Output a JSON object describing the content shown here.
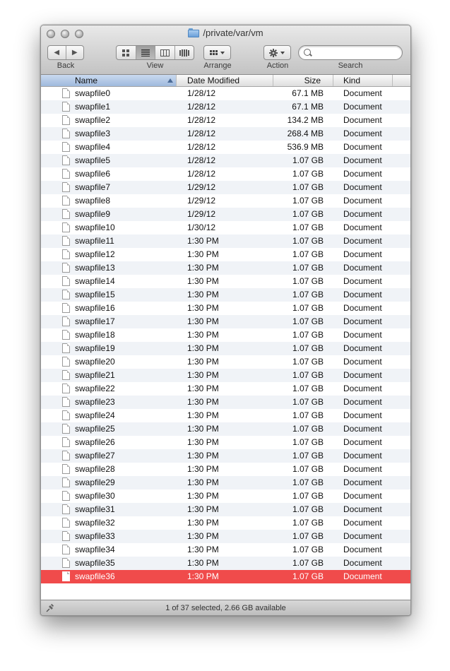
{
  "window": {
    "title": "/private/var/vm"
  },
  "toolbar": {
    "back_label": "Back",
    "view_label": "View",
    "arrange_label": "Arrange",
    "action_label": "Action",
    "search_label": "Search",
    "search_placeholder": "",
    "back_icon": "chevron-left-icon",
    "forward_icon": "chevron-right-icon",
    "view_icons": [
      "icon-view-icon",
      "list-view-icon",
      "column-view-icon",
      "cover-flow-icon"
    ],
    "arrange_icon": "arrange-grid-icon",
    "action_icon": "gear-icon"
  },
  "columns": {
    "name": "Name",
    "date": "Date Modified",
    "size": "Size",
    "kind": "Kind"
  },
  "files": [
    {
      "name": "swapfile0",
      "date": "1/28/12",
      "size": "67.1 MB",
      "kind": "Document"
    },
    {
      "name": "swapfile1",
      "date": "1/28/12",
      "size": "67.1 MB",
      "kind": "Document"
    },
    {
      "name": "swapfile2",
      "date": "1/28/12",
      "size": "134.2 MB",
      "kind": "Document"
    },
    {
      "name": "swapfile3",
      "date": "1/28/12",
      "size": "268.4 MB",
      "kind": "Document"
    },
    {
      "name": "swapfile4",
      "date": "1/28/12",
      "size": "536.9 MB",
      "kind": "Document"
    },
    {
      "name": "swapfile5",
      "date": "1/28/12",
      "size": "1.07 GB",
      "kind": "Document"
    },
    {
      "name": "swapfile6",
      "date": "1/28/12",
      "size": "1.07 GB",
      "kind": "Document"
    },
    {
      "name": "swapfile7",
      "date": "1/29/12",
      "size": "1.07 GB",
      "kind": "Document"
    },
    {
      "name": "swapfile8",
      "date": "1/29/12",
      "size": "1.07 GB",
      "kind": "Document"
    },
    {
      "name": "swapfile9",
      "date": "1/29/12",
      "size": "1.07 GB",
      "kind": "Document"
    },
    {
      "name": "swapfile10",
      "date": "1/30/12",
      "size": "1.07 GB",
      "kind": "Document"
    },
    {
      "name": "swapfile11",
      "date": "1:30 PM",
      "size": "1.07 GB",
      "kind": "Document"
    },
    {
      "name": "swapfile12",
      "date": "1:30 PM",
      "size": "1.07 GB",
      "kind": "Document"
    },
    {
      "name": "swapfile13",
      "date": "1:30 PM",
      "size": "1.07 GB",
      "kind": "Document"
    },
    {
      "name": "swapfile14",
      "date": "1:30 PM",
      "size": "1.07 GB",
      "kind": "Document"
    },
    {
      "name": "swapfile15",
      "date": "1:30 PM",
      "size": "1.07 GB",
      "kind": "Document"
    },
    {
      "name": "swapfile16",
      "date": "1:30 PM",
      "size": "1.07 GB",
      "kind": "Document"
    },
    {
      "name": "swapfile17",
      "date": "1:30 PM",
      "size": "1.07 GB",
      "kind": "Document"
    },
    {
      "name": "swapfile18",
      "date": "1:30 PM",
      "size": "1.07 GB",
      "kind": "Document"
    },
    {
      "name": "swapfile19",
      "date": "1:30 PM",
      "size": "1.07 GB",
      "kind": "Document"
    },
    {
      "name": "swapfile20",
      "date": "1:30 PM",
      "size": "1.07 GB",
      "kind": "Document"
    },
    {
      "name": "swapfile21",
      "date": "1:30 PM",
      "size": "1.07 GB",
      "kind": "Document"
    },
    {
      "name": "swapfile22",
      "date": "1:30 PM",
      "size": "1.07 GB",
      "kind": "Document"
    },
    {
      "name": "swapfile23",
      "date": "1:30 PM",
      "size": "1.07 GB",
      "kind": "Document"
    },
    {
      "name": "swapfile24",
      "date": "1:30 PM",
      "size": "1.07 GB",
      "kind": "Document"
    },
    {
      "name": "swapfile25",
      "date": "1:30 PM",
      "size": "1.07 GB",
      "kind": "Document"
    },
    {
      "name": "swapfile26",
      "date": "1:30 PM",
      "size": "1.07 GB",
      "kind": "Document"
    },
    {
      "name": "swapfile27",
      "date": "1:30 PM",
      "size": "1.07 GB",
      "kind": "Document"
    },
    {
      "name": "swapfile28",
      "date": "1:30 PM",
      "size": "1.07 GB",
      "kind": "Document"
    },
    {
      "name": "swapfile29",
      "date": "1:30 PM",
      "size": "1.07 GB",
      "kind": "Document"
    },
    {
      "name": "swapfile30",
      "date": "1:30 PM",
      "size": "1.07 GB",
      "kind": "Document"
    },
    {
      "name": "swapfile31",
      "date": "1:30 PM",
      "size": "1.07 GB",
      "kind": "Document"
    },
    {
      "name": "swapfile32",
      "date": "1:30 PM",
      "size": "1.07 GB",
      "kind": "Document"
    },
    {
      "name": "swapfile33",
      "date": "1:30 PM",
      "size": "1.07 GB",
      "kind": "Document"
    },
    {
      "name": "swapfile34",
      "date": "1:30 PM",
      "size": "1.07 GB",
      "kind": "Document"
    },
    {
      "name": "swapfile35",
      "date": "1:30 PM",
      "size": "1.07 GB",
      "kind": "Document"
    },
    {
      "name": "swapfile36",
      "date": "1:30 PM",
      "size": "1.07 GB",
      "kind": "Document",
      "selected": true
    }
  ],
  "status": {
    "text": "1 of 37 selected, 2.66 GB available"
  },
  "colors": {
    "selection": "#f04b4b",
    "alt_row": "#f0f3f7",
    "folder": "#6aa0d8"
  }
}
